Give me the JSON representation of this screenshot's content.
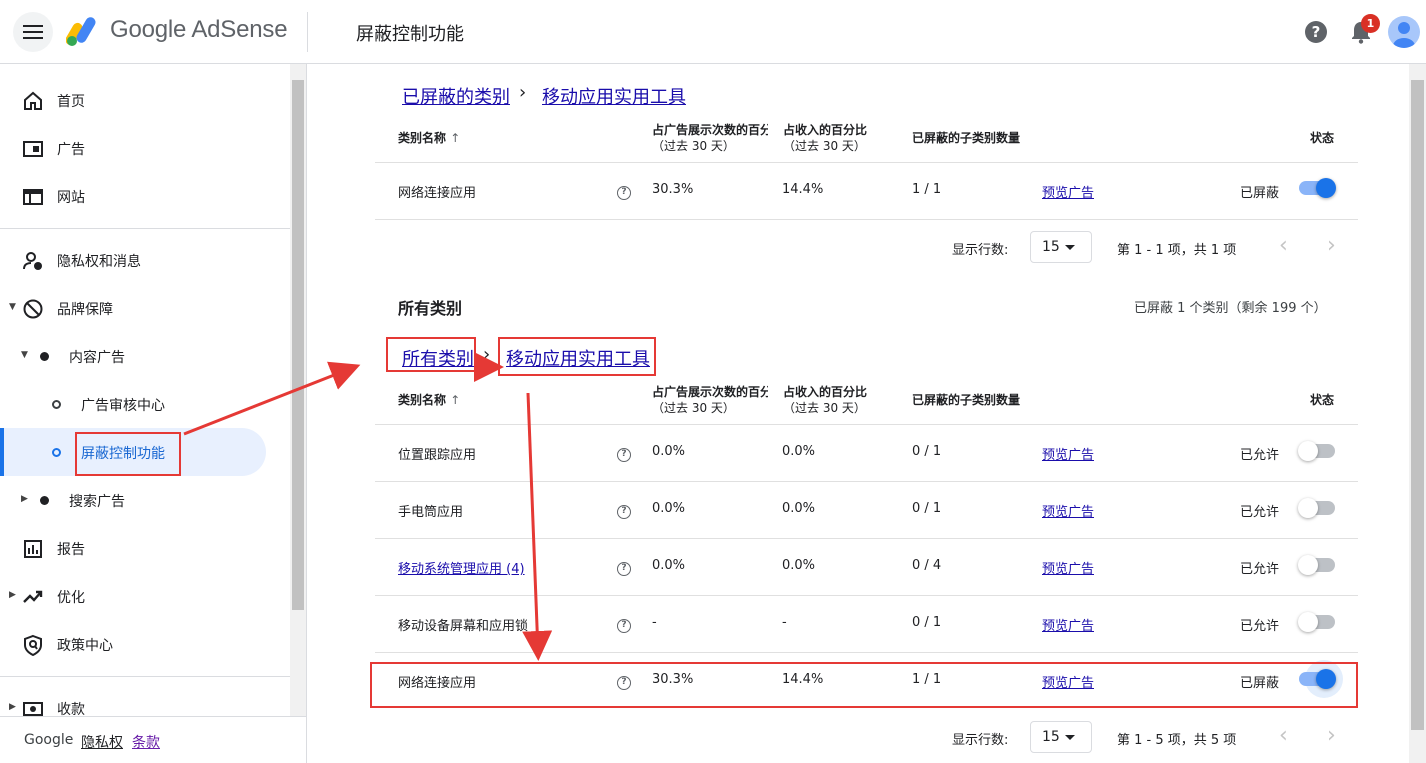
{
  "topbar": {
    "brand": "Google AdSense",
    "page_title": "屏蔽控制功能",
    "notification_count": "1"
  },
  "sidebar": {
    "items": [
      {
        "label": "首页",
        "icon": "home-icon"
      },
      {
        "label": "广告",
        "icon": "ads-icon"
      },
      {
        "label": "网站",
        "icon": "sites-icon"
      },
      {
        "label": "隐私权和消息",
        "icon": "privacy-icon"
      },
      {
        "label": "品牌保障",
        "icon": "block-icon"
      },
      {
        "label": "内容广告"
      },
      {
        "label": "广告审核中心"
      },
      {
        "label": "屏蔽控制功能"
      },
      {
        "label": "搜索广告"
      },
      {
        "label": "报告",
        "icon": "report-icon"
      },
      {
        "label": "优化",
        "icon": "trending-icon"
      },
      {
        "label": "政策中心",
        "icon": "policy-icon"
      },
      {
        "label": "收款",
        "icon": "payments-icon"
      }
    ],
    "footer": {
      "brand": "Google",
      "privacy": "隐私权",
      "terms": "条款"
    }
  },
  "blocked_section": {
    "breadcrumb": [
      "已屏蔽的类别",
      "移动应用实用工具"
    ],
    "headers": {
      "name": "类别名称",
      "impr": [
        "占广告展示次数的百分比",
        "（过去 30 天）"
      ],
      "rev": [
        "占收入的百分比",
        "（过去 30 天）"
      ],
      "sub": "已屏蔽的子类别数量",
      "status": "状态"
    },
    "rows": [
      {
        "name": "网络连接应用",
        "impr": "30.3%",
        "rev": "14.4%",
        "sub": "1 / 1",
        "preview": "预览广告",
        "status": "已屏蔽",
        "on": true
      }
    ],
    "pager": {
      "rows_label": "显示行数:",
      "rows_value": "15",
      "range": "第 1 - 1 项，共 1 项"
    }
  },
  "all_section": {
    "title": "所有类别",
    "summary": "已屏蔽 1 个类别（剩余 199 个）",
    "breadcrumb": [
      "所有类别",
      "移动应用实用工具"
    ],
    "headers": {
      "name": "类别名称",
      "impr": [
        "占广告展示次数的百分比",
        "（过去 30 天）"
      ],
      "rev": [
        "占收入的百分比",
        "（过去 30 天）"
      ],
      "sub": "已屏蔽的子类别数量",
      "status": "状态"
    },
    "rows": [
      {
        "name": "位置跟踪应用",
        "impr": "0.0%",
        "rev": "0.0%",
        "sub": "0 / 1",
        "preview": "预览广告",
        "status": "已允许",
        "on": false,
        "link": false
      },
      {
        "name": "手电筒应用",
        "impr": "0.0%",
        "rev": "0.0%",
        "sub": "0 / 1",
        "preview": "预览广告",
        "status": "已允许",
        "on": false,
        "link": false
      },
      {
        "name": "移动系统管理应用 (4)",
        "impr": "0.0%",
        "rev": "0.0%",
        "sub": "0 / 4",
        "preview": "预览广告",
        "status": "已允许",
        "on": false,
        "link": true
      },
      {
        "name": "移动设备屏幕和应用锁",
        "impr": "-",
        "rev": "-",
        "sub": "0 / 1",
        "preview": "预览广告",
        "status": "已允许",
        "on": false,
        "link": false
      },
      {
        "name": "网络连接应用",
        "impr": "30.3%",
        "rev": "14.4%",
        "sub": "1 / 1",
        "preview": "预览广告",
        "status": "已屏蔽",
        "on": true,
        "link": false
      }
    ],
    "pager": {
      "rows_label": "显示行数:",
      "rows_value": "15",
      "range": "第 1 - 5 项，共 5 项"
    }
  },
  "colors": {
    "accent": "#1a73e8",
    "link": "#1a0dab",
    "annotation": "#e53935"
  }
}
